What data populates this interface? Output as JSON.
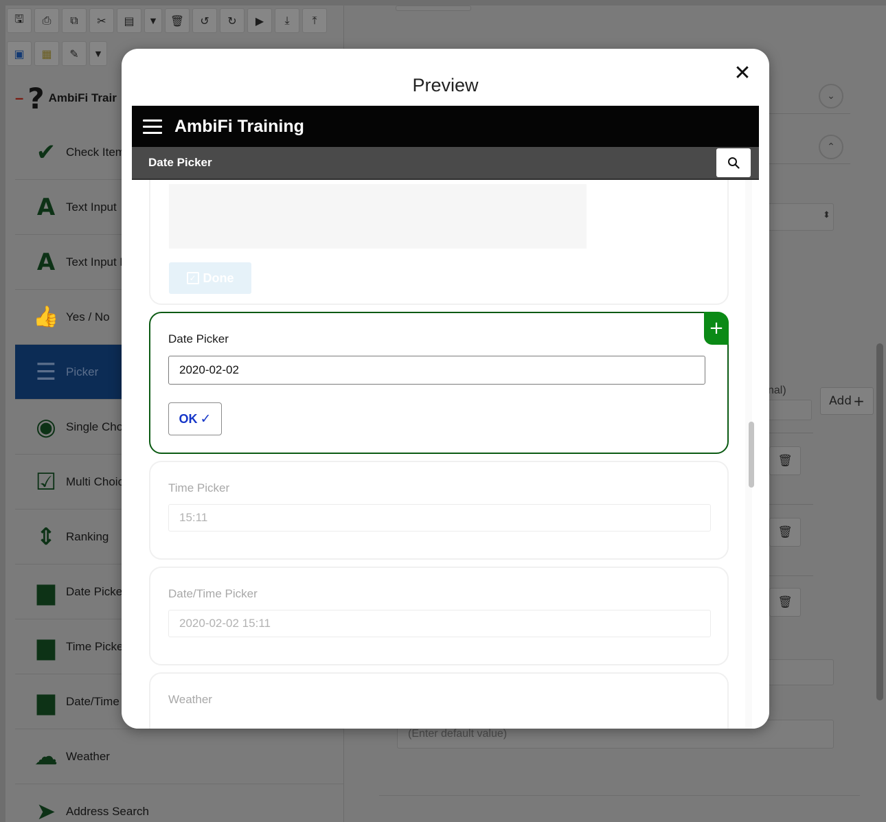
{
  "toolbar": {
    "row1_icons": [
      "save-icon",
      "print-icon",
      "copy-icon",
      "cut-icon",
      "paste-icon",
      "dropdown-caret-icon",
      "trash-icon",
      "undo-icon",
      "redo-icon",
      "play-icon",
      "download-icon",
      "upload-icon"
    ],
    "row2_icons": [
      "table-icon",
      "grid-icon",
      "edit-icon",
      "dropdown-caret-icon"
    ]
  },
  "palette": {
    "header_label": "AmbiFi Trair",
    "items": [
      {
        "label": "Check Item",
        "icon": "checkmark-icon"
      },
      {
        "label": "Text Input",
        "icon": "letter-a-icon"
      },
      {
        "label": "Text Input N",
        "icon": "letter-a-icon"
      },
      {
        "label": "Yes / No",
        "icon": "thumbs-up-icon"
      },
      {
        "label": "Picker",
        "icon": "list-icon"
      },
      {
        "label": "Single Choi",
        "icon": "radio-icon"
      },
      {
        "label": "Multi Choic",
        "icon": "checkbox-icon"
      },
      {
        "label": "Ranking",
        "icon": "sort-arrows-icon"
      },
      {
        "label": "Date Picker",
        "icon": "calendar-icon"
      },
      {
        "label": "Time Picke",
        "icon": "calendar-icon"
      },
      {
        "label": "Date/Time",
        "icon": "calendar-icon"
      },
      {
        "label": "Weather",
        "icon": "cloud-icon"
      },
      {
        "label": "Address Search",
        "icon": "navigation-arrow-icon"
      }
    ]
  },
  "background_right": {
    "optional_label_fragment": "nal)",
    "add_button_label": "Add",
    "default_value_placeholder": "(Enter default value)"
  },
  "modal": {
    "title": "Preview",
    "close_glyph": "✕"
  },
  "preview_app": {
    "app_title": "AmbiFi Training",
    "sub_title": "Date Picker",
    "cards": {
      "done_label": "Done",
      "date_picker": {
        "label": "Date Picker",
        "value": "2020-02-02",
        "ok_label": "OK",
        "ok_glyph": "✓",
        "plus_glyph": "+"
      },
      "time_picker": {
        "label": "Time Picker",
        "value": "15:11"
      },
      "datetime_picker": {
        "label": "Date/Time Picker",
        "value": "2020-02-02 15:11"
      },
      "weather": {
        "label": "Weather"
      }
    }
  }
}
